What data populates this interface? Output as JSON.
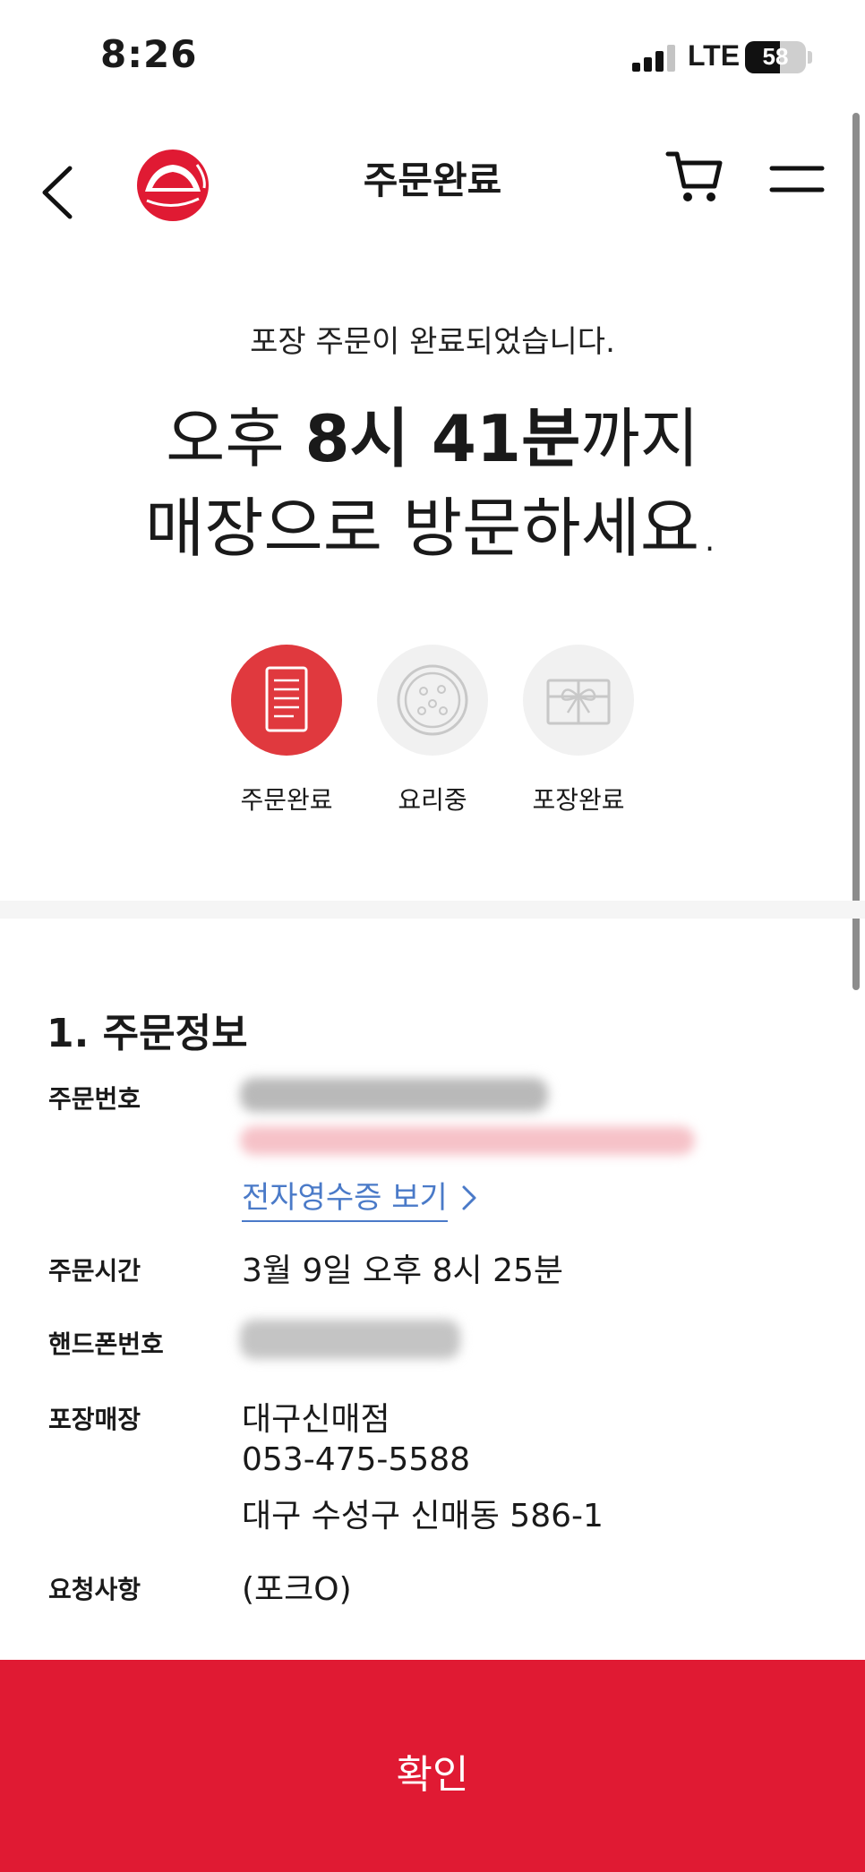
{
  "status_bar": {
    "time": "8:26",
    "network": "LTE",
    "battery": "58",
    "battery_level": 0.58
  },
  "header": {
    "title": "주문완료"
  },
  "hero": {
    "notice": "포장 주문이 완료되었습니다.",
    "line1_pre": "오후 ",
    "line1_time": "8시 41분",
    "line1_post": "까지",
    "line2": "매장으로 방문하세요."
  },
  "steps": [
    {
      "label": "주문완료",
      "active": true
    },
    {
      "label": "요리중",
      "active": false
    },
    {
      "label": "포장완료",
      "active": false
    }
  ],
  "order_info": {
    "title": "1. 주문정보",
    "order_number_label": "주문번호",
    "receipt_link": "전자영수증 보기",
    "order_time_label": "주문시간",
    "order_time": "3월 9일 오후 8시 25분",
    "phone_label": "핸드폰번호",
    "store_label": "포장매장",
    "store_name": "대구신매점",
    "store_phone": "053-475-5588",
    "store_address": "대구 수성구 신매동 586-1",
    "request_label": "요청사항",
    "request": "(포크O)"
  },
  "confirm_button": {
    "label": "확인"
  },
  "colors": {
    "accent": "#e01a33",
    "step_active": "#e0393e",
    "link": "#4a7ac8"
  }
}
